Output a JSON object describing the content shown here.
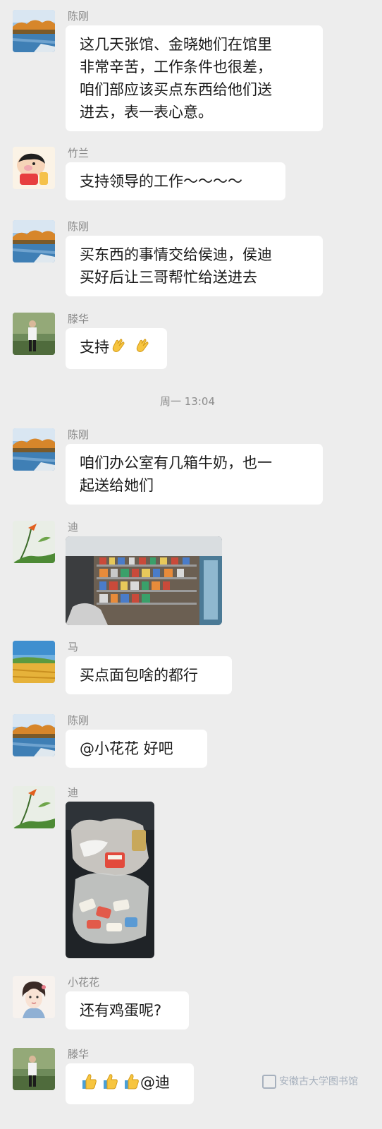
{
  "messages": [
    {
      "sender": "陈刚",
      "text": "这几天张馆、金晓她们在馆里\n非常辛苦，工作条件也很差，\n咱们部应该买点东西给他们送\n进去，表一表心意。",
      "avatar": "lake-autumn-avatar"
    },
    {
      "sender": "竹兰",
      "text": "支持领导的工作～～～～",
      "avatar": "cartoon-boy-avatar"
    },
    {
      "sender": "陈刚",
      "text": "买东西的事情交给侯迪，侯迪\n买好后让三哥帮忙给送进去",
      "avatar": "lake-autumn-avatar"
    },
    {
      "sender": "滕华",
      "text": "支持",
      "avatar": "person-standing-avatar",
      "emoji": "clapping-hands-icon"
    },
    {
      "sender": "陈刚",
      "text": "咱们办公室有几箱牛奶，也一\n起送给她们",
      "avatar": "lake-autumn-avatar"
    },
    {
      "sender": "迪",
      "image": "store-shelves-photo",
      "avatar": "flower-avatar"
    },
    {
      "sender": "马",
      "text": "买点面包啥的都行",
      "avatar": "wheat-field-avatar"
    },
    {
      "sender": "陈刚",
      "text": "@小花花  好吧",
      "avatar": "lake-autumn-avatar"
    },
    {
      "sender": "迪",
      "image": "grocery-bags-photo",
      "avatar": "flower-avatar"
    },
    {
      "sender": "小花花",
      "text": "还有鸡蛋呢?",
      "avatar": "cartoon-girl-avatar"
    },
    {
      "sender": "滕华",
      "text": "@迪",
      "avatar": "person-standing-avatar",
      "emoji": "thumbs-up-icon"
    }
  ],
  "timestamp": "周一 13:04",
  "watermark": "安徽古大学图书馆",
  "colors": {
    "background": "#ededed",
    "bubble": "#ffffff",
    "sender_name": "#888888"
  }
}
